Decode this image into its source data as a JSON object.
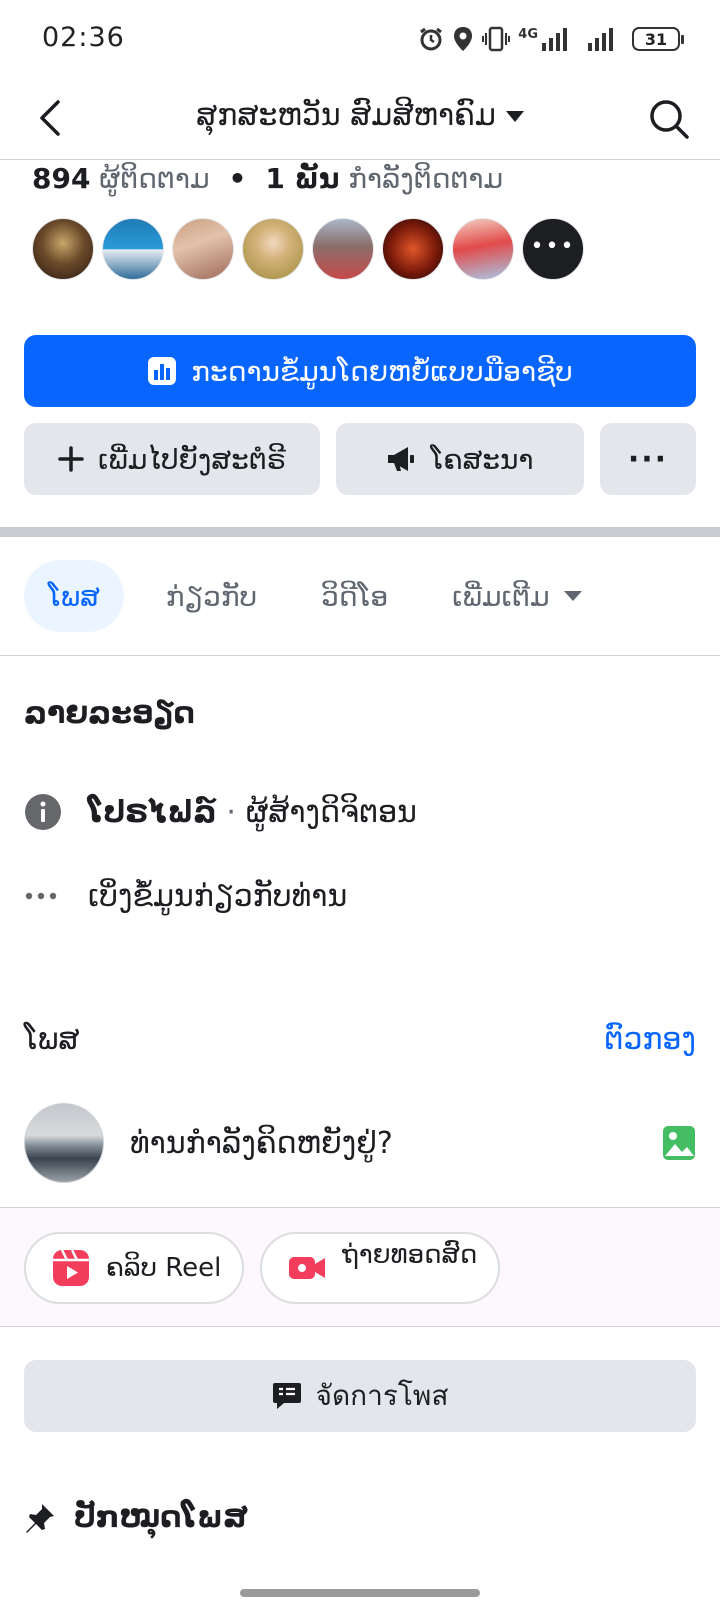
{
  "status_bar": {
    "time": "02:36",
    "network": "4G",
    "battery": "31"
  },
  "header": {
    "title": "ສຸກສະຫວັນ ສົມສີຫາຄົມ"
  },
  "counts": {
    "followers_num": "894",
    "followers_label": "ຜູ້ຕິດຕາມ",
    "following_num": "1 ພັນ",
    "following_label": "ກຳລັງຕິດຕາມ"
  },
  "dashboard_button": {
    "label": "ກະດານຂໍ້ມູນໂດຍຫຍໍ້ແບບມືອາຊີບ"
  },
  "actions": {
    "add_story": "ເພີ່ມໄປຍັງສະຕໍຣີ",
    "promote": "ໂຄສະນາ",
    "more": "···"
  },
  "tabs": [
    {
      "label": "ໂພສ"
    },
    {
      "label": "ກ່ຽວກັບ"
    },
    {
      "label": "ວິດີໂອ"
    },
    {
      "label": "ເພີ່ມເຕີມ"
    }
  ],
  "details": {
    "title": "ລາຍລະອຽດ",
    "profile_label": "ໂປຣໄຟລ໌",
    "profile_role": "ຜູ້ສ້າງດິຈິຕອນ",
    "see_about": "ເບິ່ງຂໍ້ມູນກ່ຽວກັບທ່ານ"
  },
  "posts": {
    "title": "ໂພສ",
    "filter": "ຕົວກອງ",
    "composer_placeholder": "ທ່ານກຳລັງຄິດຫຍັງຢູ່?"
  },
  "quick_actions": {
    "reel": "ຄລິບ Reel",
    "live": "ຖ່າຍທອດສົດ"
  },
  "manage_posts": {
    "label": "จัดการโพส"
  },
  "pinned": {
    "title": "ປັກໝຸດໂພສ"
  },
  "colors": {
    "accent": "#0866ff",
    "reel": "#f23e5c",
    "photo": "#45bd62"
  }
}
